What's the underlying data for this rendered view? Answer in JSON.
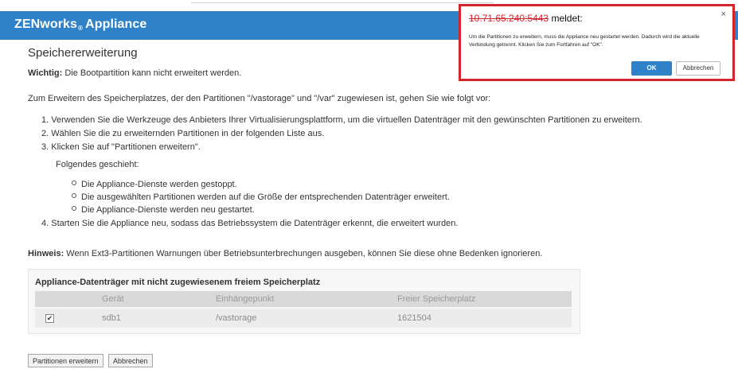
{
  "app": {
    "brand_main": "ZENworks",
    "brand_sub": "®",
    "brand_tail": "Appliance"
  },
  "page": {
    "title": "Speichererweiterung",
    "wichtig_label": "Wichtig:",
    "wichtig_text": " Die Bootpartition kann nicht erweitert werden.",
    "intro": "Zum Erweitern des Speicherplatzes, der den Partitionen \"/vastorage\" und \"/var\" zugewiesen ist, gehen Sie wie folgt vor:",
    "steps": [
      "1. Verwenden Sie die Werkzeuge des Anbieters Ihrer Virtualisierungsplattform, um die virtuellen Datenträger mit den gewünschten Partitionen zu erweitern.",
      "2. Wählen Sie die zu erweiternden Partitionen in der folgenden Liste aus.",
      "3. Klicken Sie auf \"Partitionen erweitern\"."
    ],
    "subhead": "Folgendes geschieht:",
    "bullets": [
      "Die Appliance-Dienste werden gestoppt.",
      "Die ausgewählten Partitionen werden auf die Größe der entsprechenden Datenträger erweitert.",
      "Die Appliance-Dienste werden neu gestartet."
    ],
    "step4": "4. Starten Sie die Appliance neu, sodass das Betriebssystem die Datenträger erkennt, die erweitert wurden.",
    "hinweis_label": "Hinweis:",
    "hinweis_text": " Wenn Ext3-Partitionen Warnungen über Betriebsunterbrechungen ausgeben, können Sie diese ohne Bedenken ignorieren."
  },
  "table": {
    "title": "Appliance-Datenträger mit nicht zugewiesenem freiem Speicherplatz",
    "headers": [
      "Gerät",
      "Einhängepunkt",
      "Freier Speicherplatz"
    ],
    "rows": [
      {
        "checked": true,
        "check_mark": "✔",
        "device": "sdb1",
        "mount": "/vastorage",
        "free": "1621504"
      }
    ]
  },
  "buttons": {
    "expand": "Partitionen erweitern",
    "cancel": "Abbrechen"
  },
  "dialog": {
    "host": "10.71.65.240:5443",
    "host_suffix": " meldet:",
    "close": "×",
    "message": "Um die Partitionen zu erweitern, muss die Appliance neu gestartet werden. Dadurch wird die aktuelle Verbindung getrennt. Klicken Sie zum Fortfahren auf \"OK\".",
    "ok": "OK",
    "cancel": "Abbrechen"
  },
  "colors": {
    "header": "#2f82c8",
    "highlight_border": "#d3252e",
    "ok_button": "#2f82c8"
  }
}
